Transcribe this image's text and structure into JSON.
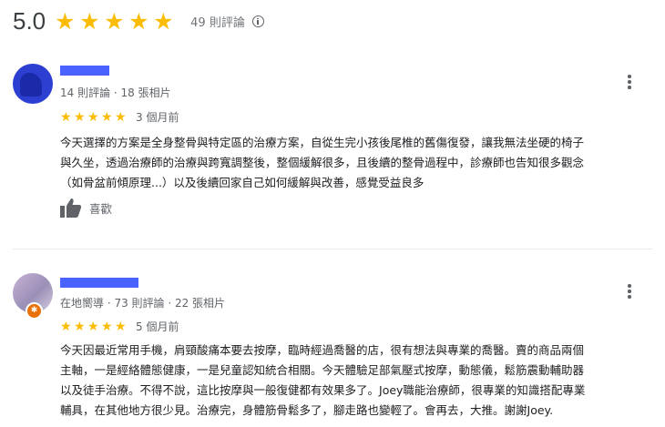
{
  "summary": {
    "score": "5.0",
    "star_count": 5,
    "review_count": "49 則評論",
    "info_icon": "info-icon"
  },
  "reviews": [
    {
      "meta": "14 則評論 · 18 張相片",
      "rating": 5,
      "time": "3 個月前",
      "text_lines": [
        "今天選擇的方案是全身整骨與特定區的治療方案，自從生完小孩後尾椎的舊傷復發，讓我無法坐硬的椅子",
        "與久坐，透過治療師的治療與跨寬調整後，整個緩解很多，且後續的整骨過程中，診療師也告知很多觀念",
        "（如骨盆前傾原理...）以及後續回家自己如何緩解與改善，感覺受益良多"
      ],
      "like_label": "喜歡"
    },
    {
      "meta": "在地嚮導 · 73 則評論 · 22 張相片",
      "rating": 5,
      "time": "5 個月前",
      "text_lines": [
        "今天因最近常用手機，肩頸酸痛本要去按摩，臨時經過喬醫的店，很有想法與專業的喬醫。賣的商品兩個",
        "主軸，一是經絡體態健康，一是兒童認知統合相關。今天體驗足部氣壓式按摩，動態儀，鬆筋震動輔助器",
        "以及徒手治療。不得不說，這比按摩與一般復健都有效果多了。Joey職能治療師，很專業的知識搭配專業",
        "輔具，在其他地方很少見。治療完，身體筋骨鬆多了，腳走路也變輕了。會再去，大推。謝謝Joey."
      ]
    }
  ],
  "colors": {
    "star": "#fbbc04",
    "redact": "#4a62ff",
    "meta_text": "#5f6368"
  }
}
